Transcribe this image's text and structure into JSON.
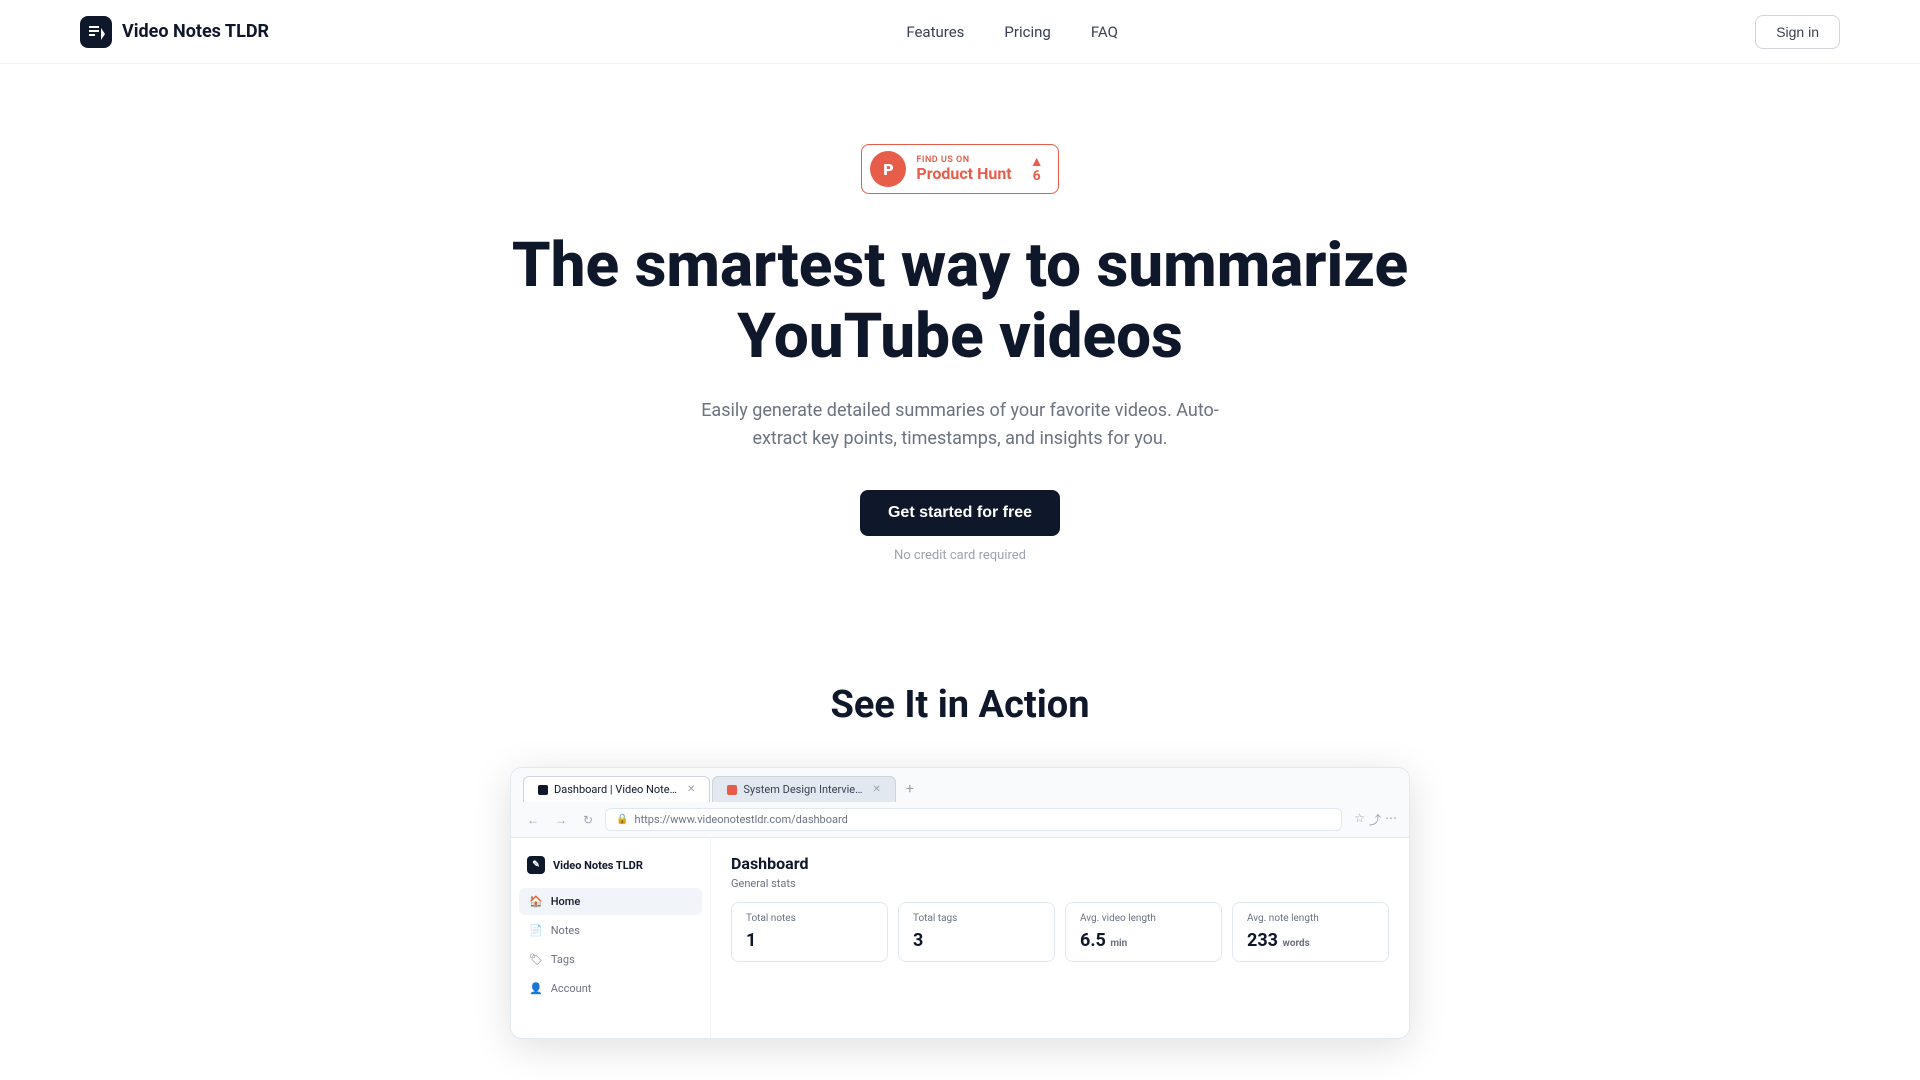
{
  "navbar": {
    "logo_text": "Video Notes TLDR",
    "links": [
      {
        "label": "Features",
        "id": "features"
      },
      {
        "label": "Pricing",
        "id": "pricing"
      },
      {
        "label": "FAQ",
        "id": "faq"
      }
    ],
    "sign_in": "Sign in"
  },
  "product_hunt": {
    "find_us_on": "FIND US ON",
    "name": "Product Hunt",
    "upvote_count": "6"
  },
  "hero": {
    "title": "The smartest way to summarize YouTube videos",
    "subtitle": "Easily generate detailed summaries of your favorite videos. Auto-extract key points, timestamps, and insights for you.",
    "cta": "Get started for free",
    "no_cc": "No credit card required"
  },
  "action_section": {
    "title": "See It in Action"
  },
  "browser": {
    "tabs": [
      {
        "label": "Dashboard | Video Note…",
        "active": true,
        "favicon": "dark"
      },
      {
        "label": "System Design Intervie…",
        "active": false,
        "favicon": "red"
      }
    ],
    "url": "https://www.videonotestldr.com/dashboard"
  },
  "sidebar": {
    "logo": "Video Notes TLDR",
    "items": [
      {
        "label": "Home",
        "icon": "🏠",
        "active": true
      },
      {
        "label": "Notes",
        "icon": "📄",
        "active": false
      },
      {
        "label": "Tags",
        "icon": "🏷",
        "active": false
      },
      {
        "label": "Account",
        "icon": "👤",
        "active": false
      }
    ]
  },
  "dashboard": {
    "title": "Dashboard",
    "subtitle": "General stats",
    "stats": [
      {
        "label": "Total notes",
        "value": "1",
        "unit": ""
      },
      {
        "label": "Total tags",
        "value": "3",
        "unit": ""
      },
      {
        "label": "Avg. video length",
        "value": "6.5",
        "unit": "min"
      },
      {
        "label": "Avg. note length",
        "value": "233",
        "unit": "words"
      }
    ]
  }
}
